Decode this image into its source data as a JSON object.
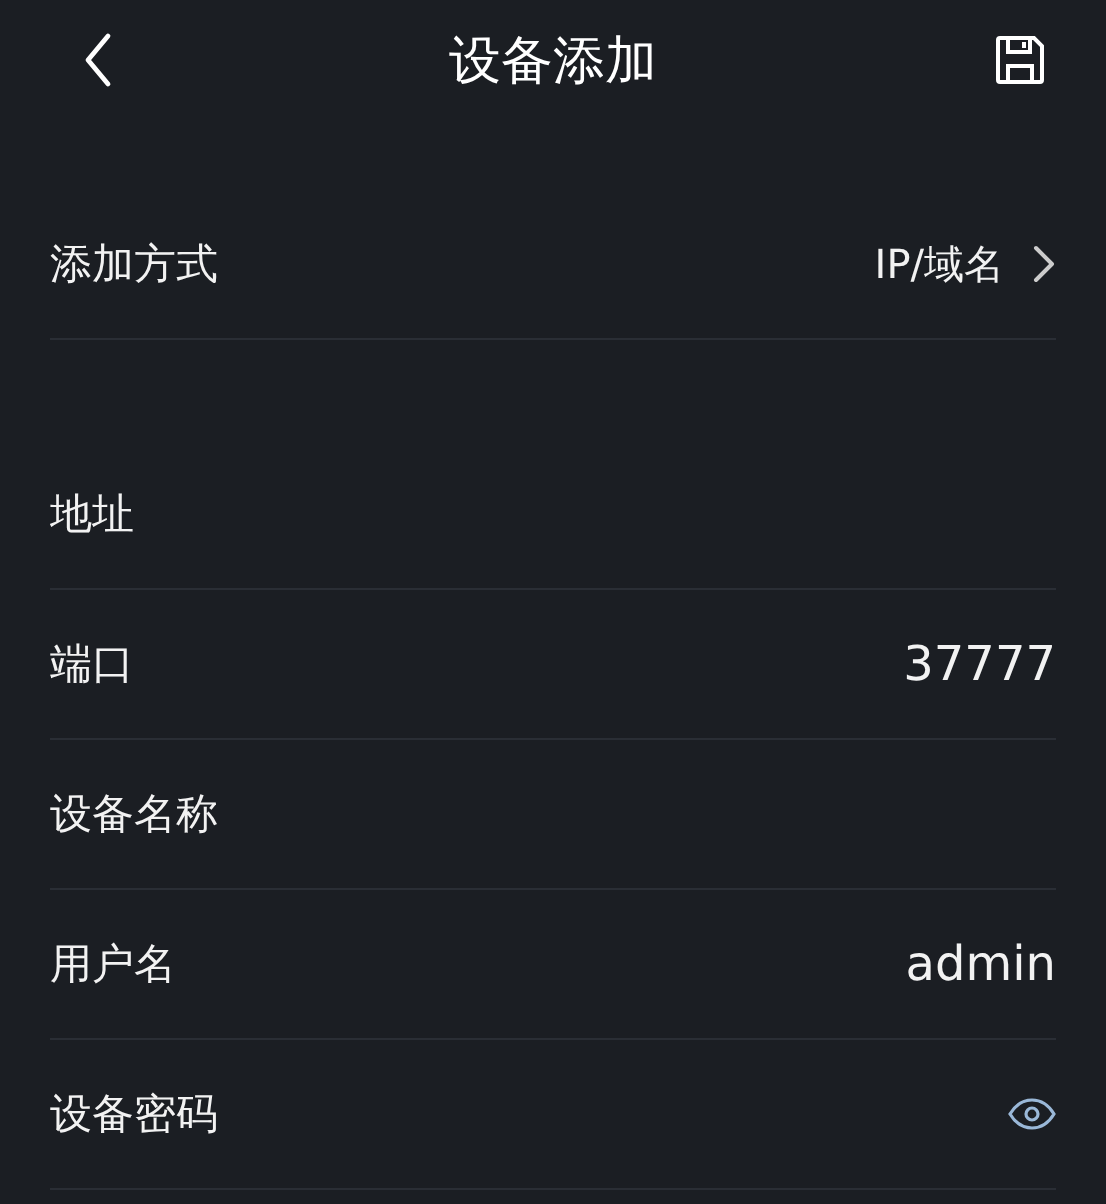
{
  "header": {
    "title": "设备添加"
  },
  "sections": [
    {
      "rows": [
        {
          "kind": "select",
          "label": "添加方式",
          "value": "IP/域名"
        }
      ]
    },
    {
      "rows": [
        {
          "kind": "text",
          "label": "地址"
        },
        {
          "kind": "text",
          "label": "端口",
          "value": "37777"
        },
        {
          "kind": "text",
          "label": "设备名称"
        },
        {
          "kind": "text",
          "label": "用户名",
          "value": "admin"
        },
        {
          "kind": "password",
          "label": "设备密码"
        }
      ]
    }
  ]
}
